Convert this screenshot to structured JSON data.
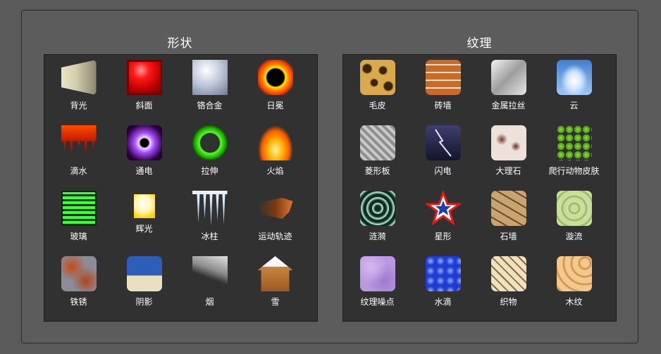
{
  "shapes": {
    "title": "形状",
    "items": [
      {
        "label": "背光",
        "icon": "backlight-icon"
      },
      {
        "label": "斜面",
        "icon": "bevel-icon"
      },
      {
        "label": "铬合金",
        "icon": "chrome-star-icon"
      },
      {
        "label": "日冕",
        "icon": "corona-icon"
      },
      {
        "label": "滴水",
        "icon": "drip-icon"
      },
      {
        "label": "通电",
        "icon": "electric-icon"
      },
      {
        "label": "拉伸",
        "icon": "extrude-ring-icon"
      },
      {
        "label": "火焰",
        "icon": "fire-icon"
      },
      {
        "label": "玻璃",
        "icon": "glass-icon"
      },
      {
        "label": "辉光",
        "icon": "glow-bulb-icon"
      },
      {
        "label": "冰柱",
        "icon": "icicle-icon"
      },
      {
        "label": "运动轨迹",
        "icon": "motion-trail-icon"
      },
      {
        "label": "铁锈",
        "icon": "rust-icon"
      },
      {
        "label": "阴影",
        "icon": "shadow-tree-icon"
      },
      {
        "label": "烟",
        "icon": "smoke-icon"
      },
      {
        "label": "雪",
        "icon": "snow-house-icon"
      }
    ]
  },
  "textures": {
    "title": "纹理",
    "items": [
      {
        "label": "毛皮",
        "icon": "fur-icon"
      },
      {
        "label": "砖墙",
        "icon": "brick-wall-icon"
      },
      {
        "label": "金属拉丝",
        "icon": "brushed-metal-icon"
      },
      {
        "label": "云",
        "icon": "clouds-icon"
      },
      {
        "label": "菱形板",
        "icon": "diamond-plate-icon"
      },
      {
        "label": "闪电",
        "icon": "lightning-icon"
      },
      {
        "label": "大理石",
        "icon": "marble-icon"
      },
      {
        "label": "爬行动物皮肤",
        "icon": "reptile-skin-icon"
      },
      {
        "label": "涟漪",
        "icon": "ripple-icon"
      },
      {
        "label": "星形",
        "icon": "star-icon"
      },
      {
        "label": "石墙",
        "icon": "stone-wall-icon"
      },
      {
        "label": "漩流",
        "icon": "swirl-icon"
      },
      {
        "label": "纹理噪点",
        "icon": "texture-noise-icon"
      },
      {
        "label": "水滴",
        "icon": "water-drops-icon"
      },
      {
        "label": "织物",
        "icon": "weave-icon"
      },
      {
        "label": "木纹",
        "icon": "wood-grain-icon"
      }
    ]
  }
}
